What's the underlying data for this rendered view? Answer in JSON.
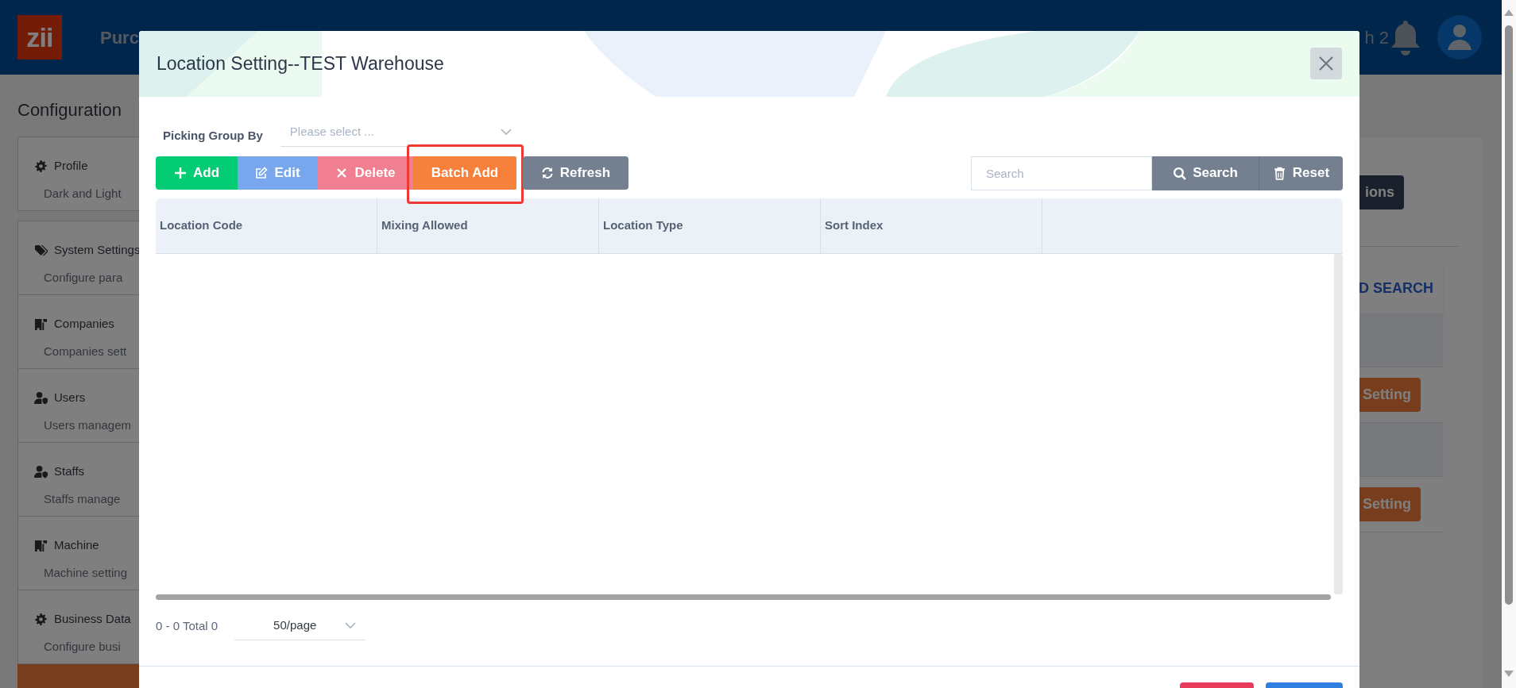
{
  "app_bar": {
    "logo": "zii",
    "title": "Purc",
    "user_label": "h 2"
  },
  "page": {
    "title": "Configuration",
    "sidebar": [
      {
        "kind": "settings",
        "title": "Profile",
        "description": "Dark and Light",
        "selected": false
      },
      {
        "kind": "tags",
        "title": "System Settings",
        "description": "Configure para",
        "selected": false
      },
      {
        "kind": "building",
        "title": "Companies",
        "description": "Companies sett",
        "selected": false
      },
      {
        "kind": "user",
        "title": "Users",
        "description": "Users managem",
        "selected": false
      },
      {
        "kind": "user",
        "title": "Staffs",
        "description": "Staffs manage",
        "selected": false
      },
      {
        "kind": "building",
        "title": "Machine",
        "description": "Machine setting",
        "selected": false
      },
      {
        "kind": "settings",
        "title": "Business Data",
        "description": "Configure busi",
        "selected": false
      },
      {
        "kind": "blank",
        "selected": true
      }
    ],
    "panel": {
      "options_button": "ions",
      "search_link": "D SEARCH",
      "rows": [
        {
          "button": "Setting"
        },
        {
          "button": "Setting"
        }
      ]
    }
  },
  "modal": {
    "title": "Location Setting--TEST Warehouse",
    "picking_group": {
      "label": "Picking Group By",
      "placeholder": "Please select ..."
    },
    "toolbar": [
      {
        "kind": "add",
        "label": "Add",
        "highlighted": false
      },
      {
        "kind": "edit",
        "label": "Edit",
        "highlighted": false
      },
      {
        "kind": "delete",
        "label": "Delete",
        "highlighted": false
      },
      {
        "kind": "batch",
        "label": "Batch Add",
        "highlighted": true
      },
      {
        "kind": "refresh",
        "label": "Refresh",
        "highlighted": false
      }
    ],
    "search": {
      "placeholder": "Search"
    },
    "search_buttons": [
      {
        "kind": "search",
        "label": "Search"
      },
      {
        "kind": "reset",
        "label": "Reset"
      }
    ],
    "table": {
      "columns": [
        "Location Code",
        "Mixing Allowed",
        "Location Type",
        "Sort Index"
      ]
    },
    "pagination": {
      "summary": "0 - 0 Total 0",
      "page_size": "50/page"
    },
    "footer_buttons": [
      {
        "kind": "cancel"
      },
      {
        "kind": "confirm"
      }
    ]
  }
}
